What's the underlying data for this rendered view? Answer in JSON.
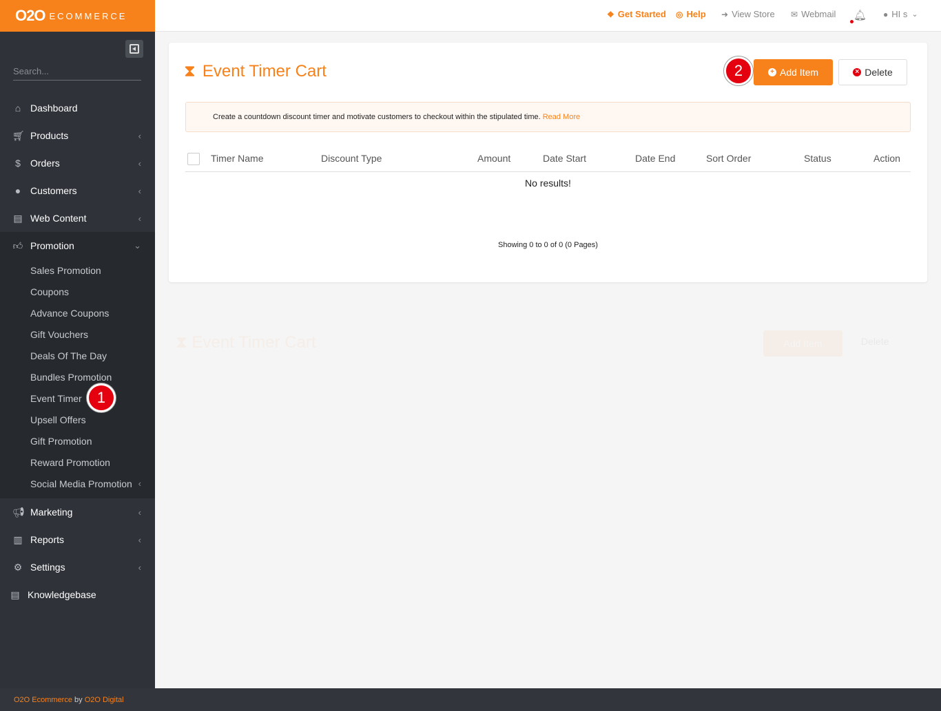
{
  "brand": {
    "logo_main": "O2O",
    "logo_sub": "ECOMMERCE"
  },
  "sidebar": {
    "search_placeholder": "Search...",
    "items": [
      {
        "label": "Dashboard",
        "icon": "home-icon"
      },
      {
        "label": "Products",
        "icon": "cart-icon"
      },
      {
        "label": "Orders",
        "icon": "dollar-icon"
      },
      {
        "label": "Customers",
        "icon": "user-icon"
      },
      {
        "label": "Web Content",
        "icon": "book-icon"
      },
      {
        "label": "Promotion",
        "icon": "thumbs-up-icon"
      }
    ],
    "promotion_sub": [
      "Sales Promotion",
      "Coupons",
      "Advance Coupons",
      "Gift Vouchers",
      "Deals Of The Day",
      "Bundles Promotion",
      "Event Timer",
      "Upsell Offers",
      "Gift Promotion",
      "Reward Promotion",
      "Social Media Promotion"
    ],
    "items_after": [
      {
        "label": "Marketing",
        "icon": "megaphone-icon"
      },
      {
        "label": "Reports",
        "icon": "bar-chart-icon"
      },
      {
        "label": "Settings",
        "icon": "gears-icon"
      },
      {
        "label": "Knowledgebase",
        "icon": "book-icon"
      }
    ]
  },
  "topbar": {
    "get_started": "Get Started",
    "help": "Help",
    "view_store": "View Store",
    "webmail": "Webmail",
    "user": "HI s"
  },
  "page": {
    "title": "Event Timer Cart",
    "add_label": "Add Item",
    "delete_label": "Delete",
    "notice": "Create a countdown discount timer and motivate customers to checkout within the stipulated time.",
    "read_more": "Read More",
    "columns": [
      "Timer Name",
      "Discount Type",
      "Amount",
      "Date Start",
      "Date End",
      "Sort Order",
      "Status",
      "Action"
    ],
    "no_results": "No results!",
    "showing": "Showing 0 to 0 of 0 (0 Pages)"
  },
  "annotations": {
    "badge1": "1",
    "badge2": "2"
  },
  "footer": {
    "part1": "O2O Ecommerce",
    "by": " by ",
    "part2": "O2O Digital"
  },
  "colors": {
    "accent": "#f7821b",
    "sidebar": "#2f3339",
    "badge": "#e4000f"
  }
}
